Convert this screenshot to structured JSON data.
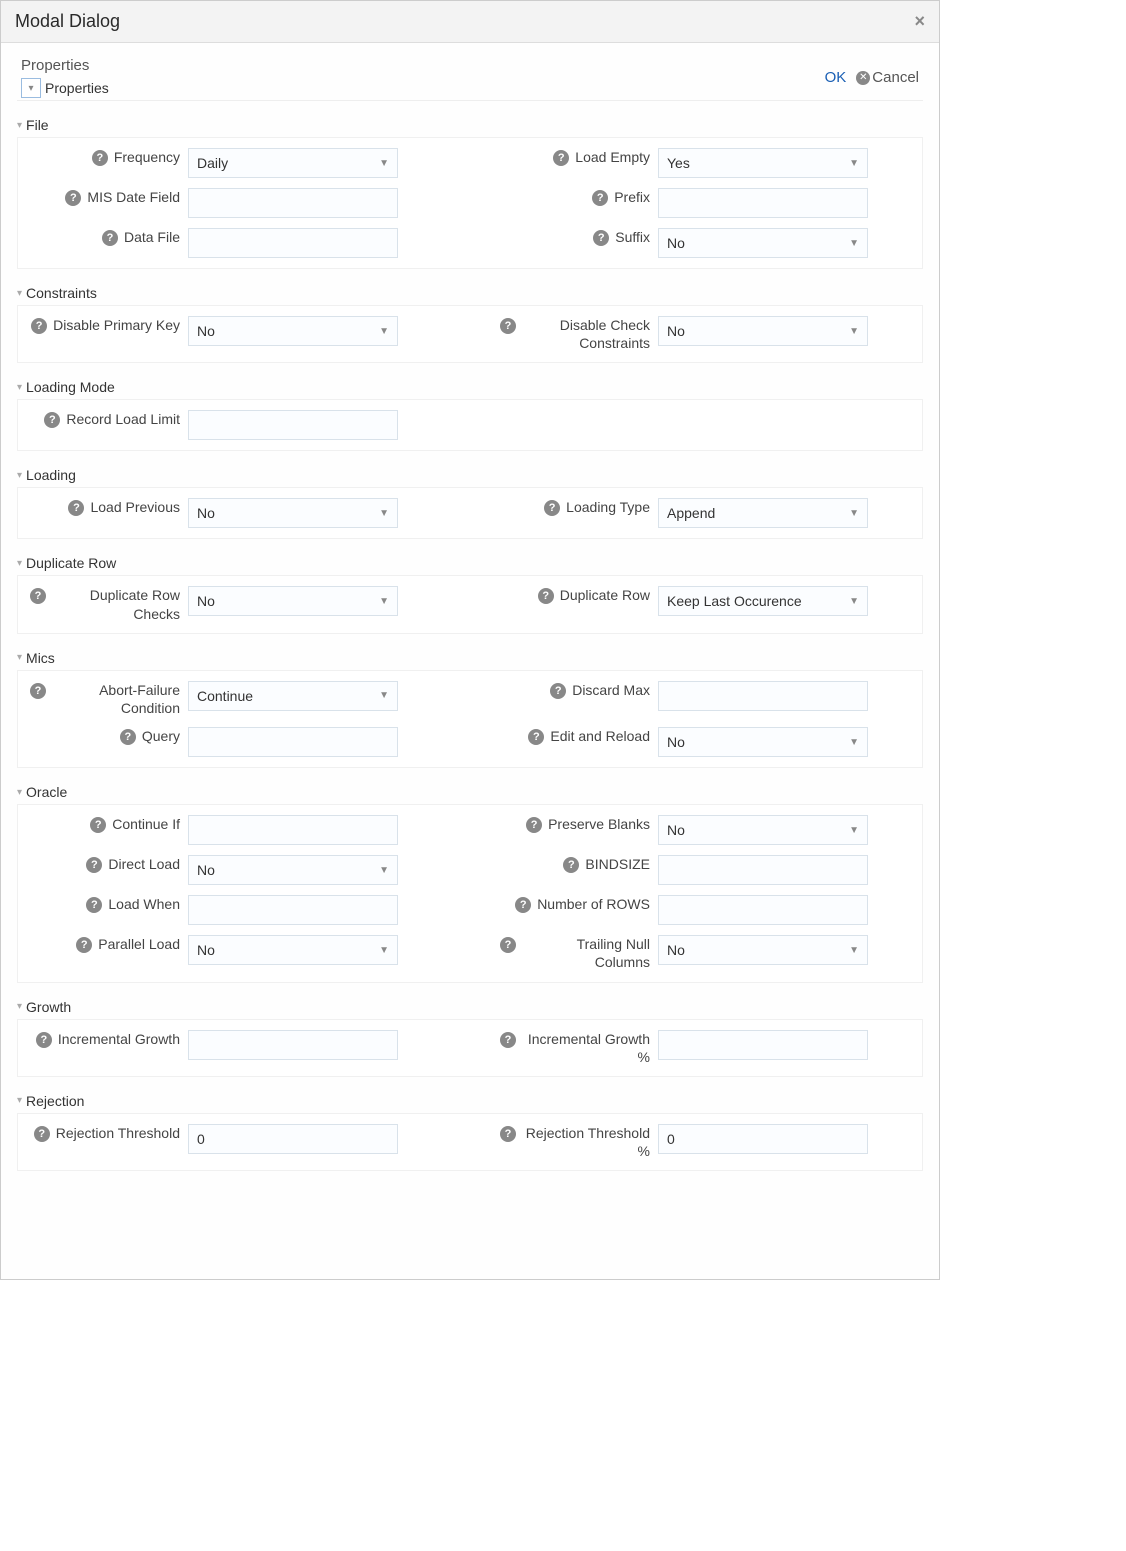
{
  "dialog": {
    "title": "Modal Dialog"
  },
  "header": {
    "label": "Properties",
    "collapse_label": "Properties",
    "ok": "OK",
    "cancel": "Cancel"
  },
  "sections": {
    "file": {
      "title": "File",
      "frequency_label": "Frequency",
      "frequency_value": "Daily",
      "mis_label": "MIS Date Field",
      "mis_value": "",
      "datafile_label": "Data File",
      "datafile_value": "",
      "loadempty_label": "Load Empty",
      "loadempty_value": "Yes",
      "prefix_label": "Prefix",
      "prefix_value": "",
      "suffix_label": "Suffix",
      "suffix_value": "No"
    },
    "constraints": {
      "title": "Constraints",
      "disable_pk_label": "Disable Primary Key",
      "disable_pk_value": "No",
      "disable_cc_label": "Disable Check Constraints",
      "disable_cc_value": "No"
    },
    "loading_mode": {
      "title": "Loading Mode",
      "rll_label": "Record Load Limit",
      "rll_value": ""
    },
    "loading": {
      "title": "Loading",
      "load_prev_label": "Load Previous",
      "load_prev_value": "No",
      "load_type_label": "Loading Type",
      "load_type_value": "Append"
    },
    "dup": {
      "title": "Duplicate Row",
      "dup_checks_label": "Duplicate Row Checks",
      "dup_checks_value": "No",
      "dup_row_label": "Duplicate Row",
      "dup_row_value": "Keep Last Occurence"
    },
    "mics": {
      "title": "Mics",
      "abort_label": "Abort-Failure Condition",
      "abort_value": "Continue",
      "query_label": "Query",
      "query_value": "",
      "discard_label": "Discard Max",
      "discard_value": "",
      "edit_reload_label": "Edit and Reload",
      "edit_reload_value": "No"
    },
    "oracle": {
      "title": "Oracle",
      "cont_label": "Continue If",
      "cont_value": "",
      "direct_label": "Direct Load",
      "direct_value": "No",
      "loadwhen_label": "Load When",
      "loadwhen_value": "",
      "parallel_label": "Parallel Load",
      "parallel_value": "No",
      "preserve_label": "Preserve Blanks",
      "preserve_value": "No",
      "bind_label": "BINDSIZE",
      "bind_value": "",
      "rows_label": "Number of ROWS",
      "rows_value": "",
      "trail_label": "Trailing Null Columns",
      "trail_value": "No"
    },
    "growth": {
      "title": "Growth",
      "inc_label": "Incremental Growth",
      "inc_value": "",
      "inc_pct_label": "Incremental Growth %",
      "inc_pct_value": ""
    },
    "rejection": {
      "title": "Rejection",
      "rej_label": "Rejection Threshold",
      "rej_value": "0",
      "rej_pct_label": "Rejection Threshold %",
      "rej_pct_value": "0"
    }
  }
}
